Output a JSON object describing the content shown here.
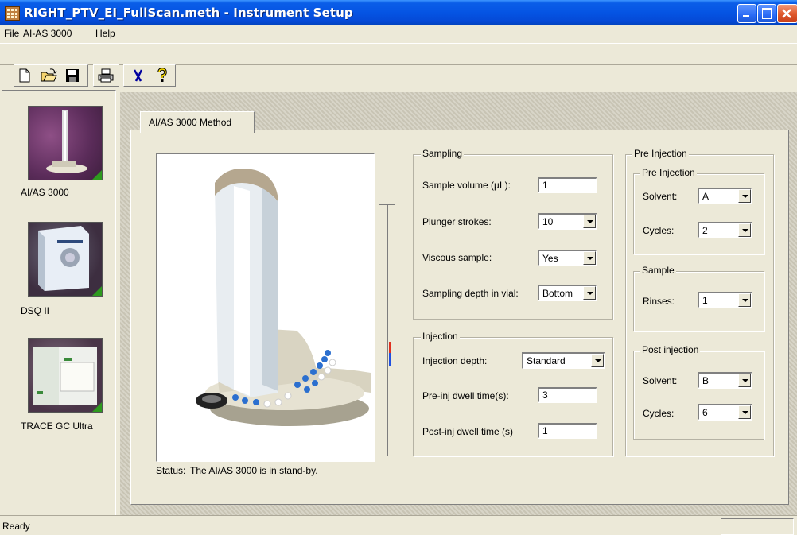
{
  "window": {
    "title": "RIGHT_PTV_EI_FullScan.meth - Instrument Setup",
    "controls": [
      "minimize-icon",
      "maximize-icon",
      "close-icon"
    ]
  },
  "menu": [
    "File",
    "AI-AS 3000",
    "Help"
  ],
  "toolbar": [
    "new-file-icon",
    "open-folder-icon",
    "save-icon",
    "print-icon",
    "cut-icon",
    "help-icon"
  ],
  "sidebar": {
    "items": [
      {
        "label": "AI/AS 3000",
        "icon": "autosampler-icon"
      },
      {
        "label": "DSQ II",
        "icon": "mass-spec-icon"
      },
      {
        "label": "TRACE GC Ultra",
        "icon": "gc-icon"
      }
    ]
  },
  "tab": {
    "label": "AI/AS 3000 Method"
  },
  "status": {
    "label": "Status:",
    "text": "The AI/AS 3000 is in stand-by."
  },
  "sampling": {
    "title": "Sampling",
    "sample_volume_label": "Sample volume (µL):",
    "sample_volume": "1",
    "plunger_strokes_label": "Plunger strokes:",
    "plunger_strokes": "10",
    "viscous_label": "Viscous sample:",
    "viscous": "Yes",
    "depth_label": "Sampling depth in vial:",
    "depth": "Bottom"
  },
  "injection": {
    "title": "Injection",
    "depth_label": "Injection depth:",
    "depth": "Standard",
    "pre_dwell_label": "Pre-inj dwell time(s):",
    "pre_dwell": "3",
    "post_dwell_label": "Post-inj dwell time (s)",
    "post_dwell": "1"
  },
  "pre_injection": {
    "title": "Pre Injection",
    "inner_title": "Pre Injection",
    "solvent_label": "Solvent:",
    "solvent": "A",
    "cycles_label": "Cycles:",
    "cycles": "2"
  },
  "sample": {
    "title": "Sample",
    "rinses_label": "Rinses:",
    "rinses": "1"
  },
  "post_injection": {
    "title": "Post injection",
    "solvent_label": "Solvent:",
    "solvent": "B",
    "cycles_label": "Cycles:",
    "cycles": "6"
  },
  "statusbar": {
    "text": "Ready"
  },
  "colors": {
    "titlebar": "#0554e3",
    "face": "#ece9d8",
    "nav_indicator": "#2e9a1e"
  }
}
